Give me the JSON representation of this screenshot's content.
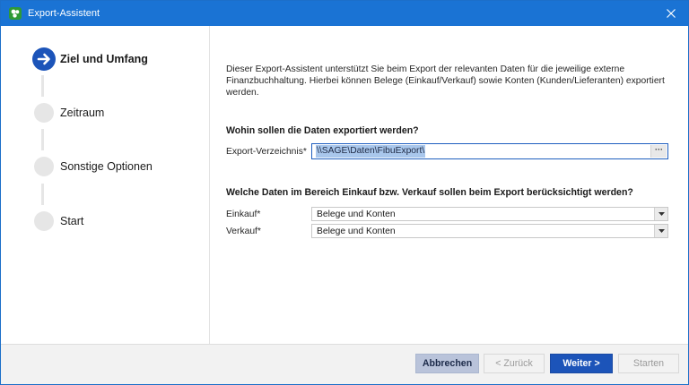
{
  "window": {
    "title": "Export-Assistent",
    "close_glyph": "✕"
  },
  "steps": [
    {
      "label": "Ziel und Umfang",
      "active": true
    },
    {
      "label": "Zeitraum",
      "active": false
    },
    {
      "label": "Sonstige Optionen",
      "active": false
    },
    {
      "label": "Start",
      "active": false
    }
  ],
  "content": {
    "intro": "Dieser Export-Assistent unterstützt Sie beim Export der relevanten Daten für die jeweilige externe Finanzbuchhaltung. Hierbei können Belege (Einkauf/Verkauf) sowie Konten (Kunden/Lieferanten) exportiert werden.",
    "section1": {
      "heading": "Wohin sollen die Daten exportiert werden?",
      "label": "Export-Verzeichnis*",
      "value": "\\\\SAGE\\Daten\\FibuExport\\",
      "browse": "···"
    },
    "section2": {
      "heading": "Welche Daten im Bereich Einkauf bzw. Verkauf sollen beim Export berücksichtigt werden?",
      "einkauf_label": "Einkauf*",
      "einkauf_value": "Belege und Konten",
      "verkauf_label": "Verkauf*",
      "verkauf_value": "Belege und Konten"
    }
  },
  "buttons": {
    "cancel": "Abbrechen",
    "back": "< Zurück",
    "next": "Weiter >",
    "start": "Starten"
  },
  "colors": {
    "titlebar": "#1a73d4",
    "accent": "#1c54b9",
    "step_inactive": "#e6e6e6",
    "selection": "#a9c7ec"
  }
}
